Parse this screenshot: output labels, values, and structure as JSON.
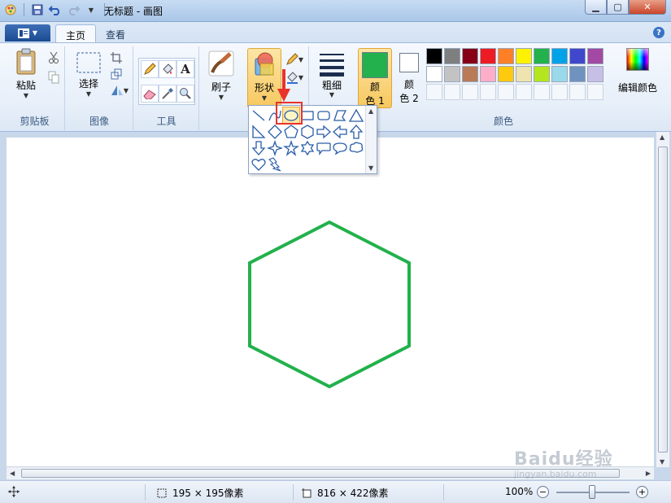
{
  "window": {
    "title": "无标题 - 画图"
  },
  "tabs": [
    {
      "label": "主页",
      "active": true
    },
    {
      "label": "查看",
      "active": false
    }
  ],
  "ribbon": {
    "clipboard": {
      "paste_label": "粘贴",
      "group_label": "剪贴板"
    },
    "image": {
      "select_label": "选择",
      "group_label": "图像"
    },
    "tools": {
      "group_label": "工具"
    },
    "brush": {
      "label": "刷子"
    },
    "shapes": {
      "label": "形状"
    },
    "size": {
      "label": "粗细"
    },
    "color1": {
      "label_line1": "颜",
      "label_line2": "色 1",
      "color": "#22b14c"
    },
    "color2": {
      "label_line1": "颜",
      "label_line2": "色 2",
      "color": "#ffffff"
    },
    "edit_colors": {
      "label": "编辑颜色"
    },
    "colors_group_label": "颜色",
    "palette_row1": [
      "#000000",
      "#7f7f7f",
      "#880015",
      "#ed1c24",
      "#ff7f27",
      "#fff200",
      "#22b14c",
      "#00a2e8",
      "#3f48cc",
      "#a349a4"
    ],
    "palette_row2": [
      "#ffffff",
      "#c3c3c3",
      "#b97a57",
      "#ffaec9",
      "#ffc90e",
      "#efe4b0",
      "#b5e61d",
      "#99d9ea",
      "#7092be",
      "#c8bfe7"
    ]
  },
  "shapes_menu": {
    "items": [
      "line-icon",
      "curve-icon",
      "oval-icon",
      "rectangle-icon",
      "rounded-rectangle-icon",
      "polygon-icon",
      "triangle-icon",
      "right-triangle-icon",
      "diamond-icon",
      "pentagon-icon",
      "hexagon-icon",
      "right-arrow-icon",
      "left-arrow-icon",
      "up-arrow-icon",
      "down-arrow-icon",
      "four-point-star-icon",
      "five-point-star-icon",
      "six-point-star-icon",
      "rounded-callout-icon",
      "oval-callout-icon",
      "cloud-callout-icon",
      "heart-icon",
      "lightning-icon"
    ],
    "selected": "oval-icon"
  },
  "canvas": {
    "stroke_color": "#22b14c"
  },
  "status": {
    "selection_size": "195 × 195像素",
    "canvas_size": "816 × 422像素",
    "zoom": "100%"
  },
  "watermark": {
    "text": "Baidu经验",
    "subtext": "jingyan.baidu.com"
  }
}
